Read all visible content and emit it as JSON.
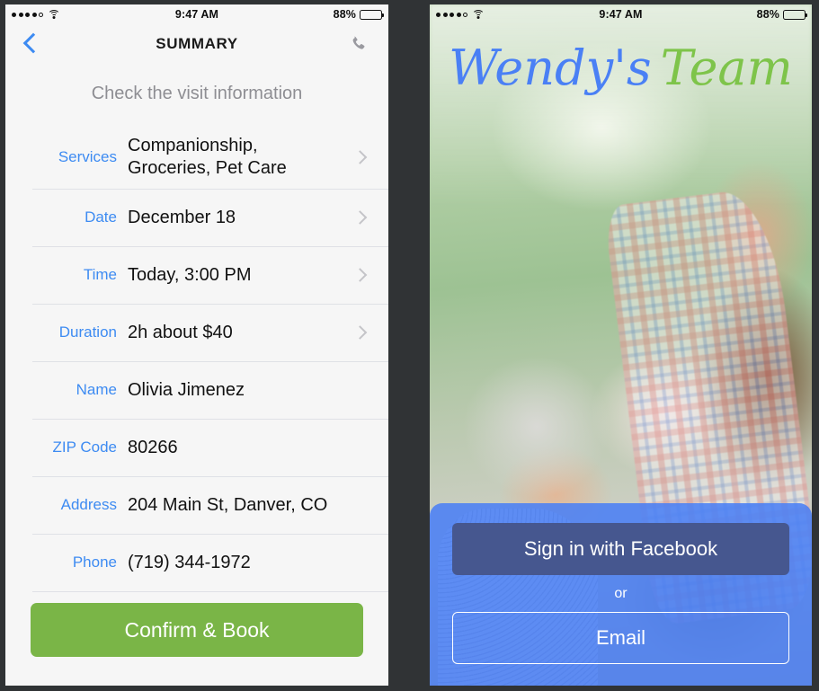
{
  "status_bar": {
    "signal_dots_filled": 4,
    "signal_dots_total": 5,
    "wifi_icon": "wifi-icon",
    "time": "9:47 AM",
    "battery_percent": "88%",
    "battery_level": 88
  },
  "left_phone": {
    "nav": {
      "back_icon": "chevron-left-icon",
      "title": "SUMMARY",
      "phone_icon": "phone-call-icon"
    },
    "subtitle": "Check the visit information",
    "rows": [
      {
        "label": "Services",
        "value": "Companionship,\nGroceries, Pet Care",
        "chevron": true
      },
      {
        "label": "Date",
        "value": "December 18",
        "chevron": true
      },
      {
        "label": "Time",
        "value": "Today, 3:00 PM",
        "chevron": true
      },
      {
        "label": "Duration",
        "value": "2h about $40",
        "chevron": true
      },
      {
        "label": "Name",
        "value": "Olivia Jimenez",
        "chevron": false
      },
      {
        "label": "ZIP Code",
        "value": "80266",
        "chevron": false
      },
      {
        "label": "Address",
        "value": "204 Main St, Danver, CO",
        "chevron": false
      },
      {
        "label": "Phone",
        "value": "(719) 344-1972",
        "chevron": false
      }
    ],
    "confirm_button": "Confirm & Book",
    "colors": {
      "label_blue": "#3d8bf2",
      "confirm_green": "#7ab547",
      "screen_bg": "#f6f6f6",
      "separator": "#dfe1e6"
    }
  },
  "right_phone": {
    "logo": {
      "first_word": "Wendy's",
      "second_word": "Team"
    },
    "photo_alt": "elderly-woman-and-caregiver-photo",
    "signin": {
      "facebook_button": "Sign in with Facebook",
      "divider": "or",
      "email_button": "Email"
    },
    "colors": {
      "panel_blue": "#4a80f5",
      "facebook_blue": "#46578f",
      "logo_blue": "#4a80f5",
      "logo_green": "#7ec44a"
    }
  }
}
